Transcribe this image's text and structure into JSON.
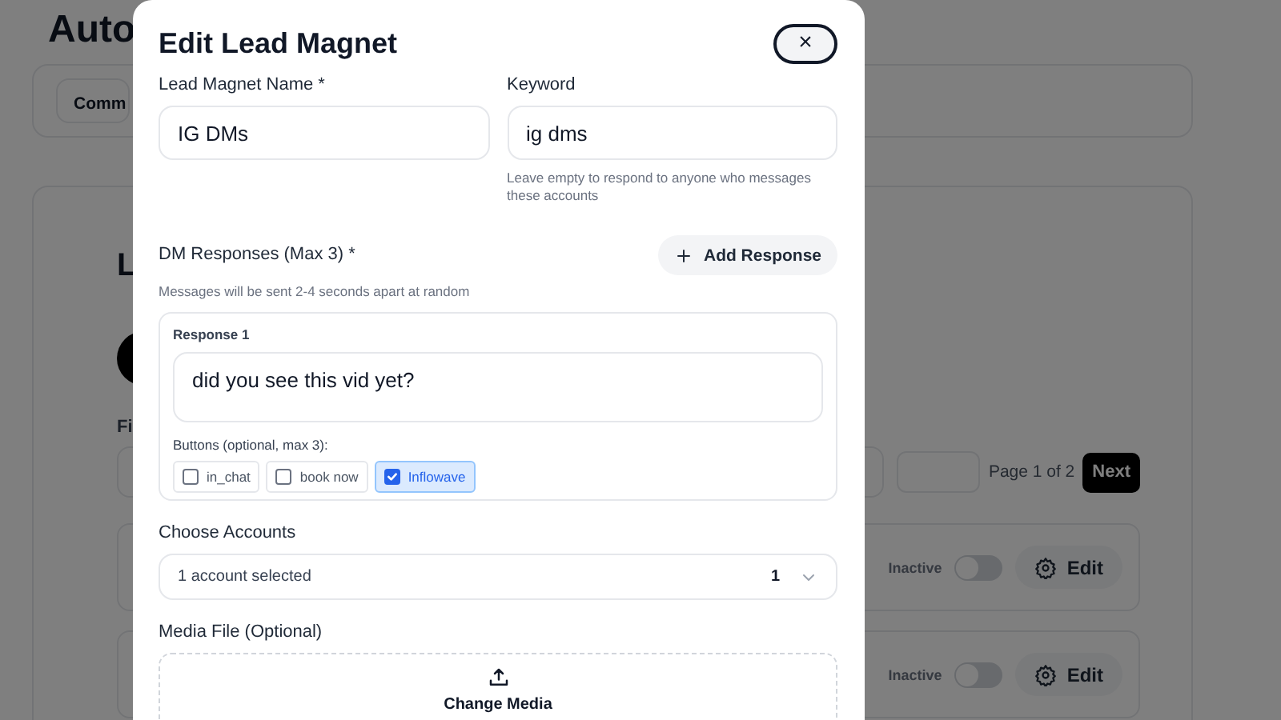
{
  "background": {
    "title": "Auto",
    "tab": "Comm",
    "section_title": "L",
    "filter_label": "Fi",
    "pagination": {
      "page": "Page 1 of 2",
      "next": "Next"
    },
    "rows": [
      {
        "status": "Inactive",
        "active": false,
        "edit": "Edit"
      },
      {
        "status": "Inactive",
        "active": false,
        "edit": "Edit"
      }
    ]
  },
  "modal": {
    "title": "Edit Lead Magnet",
    "close": "×",
    "name": {
      "label": "Lead Magnet Name *",
      "value": "IG DMs"
    },
    "keyword": {
      "label": "Keyword",
      "value": "ig dms",
      "hint": "Leave empty to respond to anyone who messages these accounts"
    },
    "responses": {
      "label": "DM Responses (Max 3) *",
      "add_button": "Add Response",
      "hint": "Messages will be sent 2-4 seconds apart at random",
      "items": [
        {
          "title": "Response 1",
          "message": "did you see this vid yet?",
          "buttons_label": "Buttons (optional, max 3):",
          "buttons": [
            {
              "label": "in_chat",
              "checked": false
            },
            {
              "label": "book now",
              "checked": false
            },
            {
              "label": "Inflowave",
              "checked": true
            }
          ]
        }
      ]
    },
    "accounts": {
      "label": "Choose Accounts",
      "value": "1 account selected",
      "count": "1"
    },
    "media": {
      "label": "Media File (Optional)",
      "action": "Change Media"
    }
  }
}
